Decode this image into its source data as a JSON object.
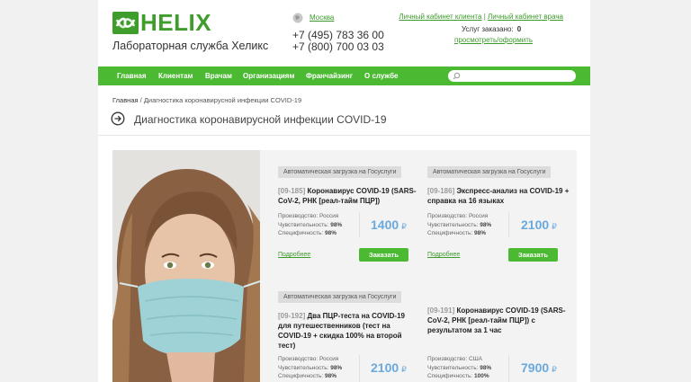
{
  "brand": {
    "name": "HELIX",
    "subtitle": "Лабораторная служба Хеликс",
    "color": "#3f9d2c"
  },
  "header": {
    "city": "Москва",
    "phones": [
      "+7 (495) 783 36 00",
      "+7 (800) 700 03 03"
    ],
    "client_link": "Личный кабинет клиента",
    "separator": "|",
    "doctor_link": "Личный кабинет врача",
    "ordered_label": "Услуг заказано:",
    "ordered_count": "0",
    "view_order": "просмотреть/оформить"
  },
  "nav": {
    "items": [
      "Главная",
      "Клиентам",
      "Врачам",
      "Организациям",
      "Франчайзинг",
      "О службе"
    ],
    "color": "#4cb932"
  },
  "breadcrumb": {
    "home": "Главная",
    "sep": " / ",
    "current": "Диагностика коронавирусной инфекции COVID-19"
  },
  "page_title": "Диагностика коронавирусной инфекции COVID-19",
  "cards": [
    {
      "tag": "Автоматическая загрузка на Госуслуги",
      "code": "[09-185]",
      "title": "Коронавирус COVID-19 (SARS-CoV-2, РНК [реал-тайм ПЦР])",
      "prod_label": "Производство:",
      "prod": "Россия",
      "sens_label": "Чувствительность:",
      "sens": "98%",
      "spec_label": "Специфичность:",
      "spec": "98%",
      "price": "1400",
      "currency": "₽",
      "more": "Подробнее",
      "order": "Заказать"
    },
    {
      "tag": "Автоматическая загрузка на Госуслуги",
      "code": "[09-186]",
      "title": "Экспресс-анализ на COVID-19 + справка на 16 языках",
      "prod_label": "Производство:",
      "prod": "Россия",
      "sens_label": "Чувствительность:",
      "sens": "98%",
      "spec_label": "Специфичность:",
      "spec": "98%",
      "price": "2100",
      "currency": "₽",
      "more": "Подробнее",
      "order": "Заказать"
    },
    {
      "tag": "Автоматическая загрузка на Госуслуги",
      "code": "[09-192]",
      "title": "Два ПЦР-теста на COVID-19 для путешественников (тест на COVID-19 + скидка 100% на второй тест)",
      "prod_label": "Производство:",
      "prod": "Россия",
      "sens_label": "Чувствительность:",
      "sens": "98%",
      "spec_label": "Специфичность:",
      "spec": "98%",
      "price": "2100",
      "currency": "₽"
    },
    {
      "tag": "",
      "code": "[09-191]",
      "title": "Коронавирус COVID-19 (SARS-CoV-2, РНК [реал-тайм ПЦР]) с результатом за 1 час",
      "prod_label": "Производство:",
      "prod": "США",
      "sens_label": "Чувствительность:",
      "sens": "98%",
      "spec_label": "Специфичность:",
      "spec": "100%",
      "price": "7900",
      "currency": "₽"
    }
  ]
}
